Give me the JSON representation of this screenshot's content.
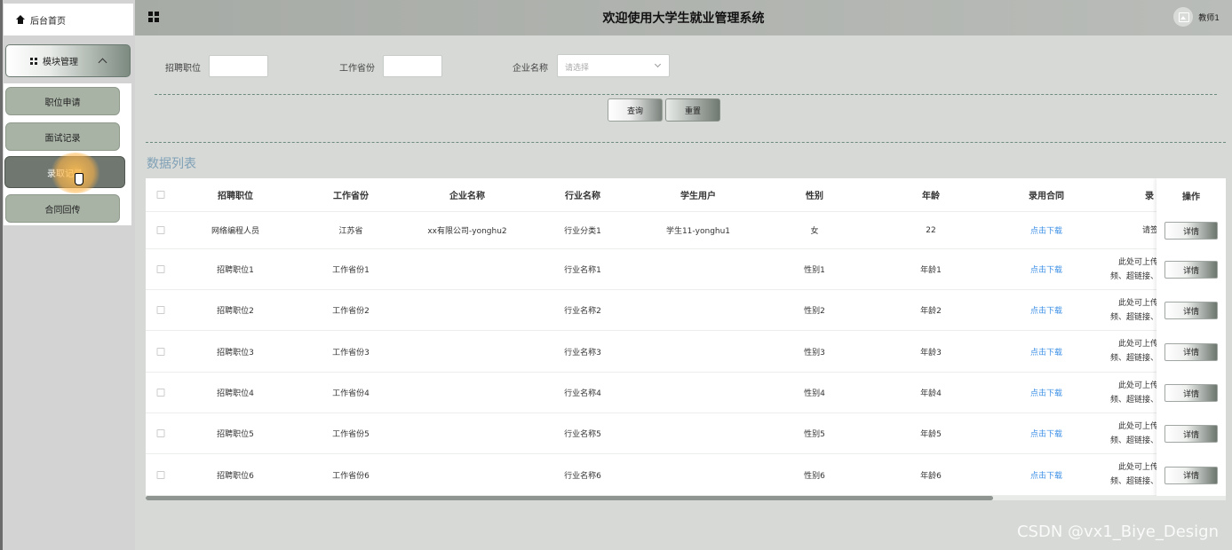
{
  "app": {
    "title": "欢迎使用大学生就业管理系统",
    "user": "教师1"
  },
  "sidebar": {
    "home_label": "后台首页",
    "module_label": "模块管理",
    "items": [
      {
        "label": "职位申请"
      },
      {
        "label": "面试记录"
      },
      {
        "label": "录取记录"
      },
      {
        "label": "合同回传"
      }
    ]
  },
  "filters": {
    "position_label": "招聘职位",
    "province_label": "工作省份",
    "company_label": "企业名称",
    "company_placeholder": "请选择",
    "position_value": "",
    "province_value": ""
  },
  "actions": {
    "query": "查询",
    "reset": "重置"
  },
  "list": {
    "title": "数据列表",
    "columns": [
      "招聘职位",
      "工作省份",
      "企业名称",
      "行业名称",
      "学生用户",
      "性别",
      "年龄",
      "录用合同",
      "录",
      "操作"
    ],
    "rows": [
      {
        "position": "网络编程人员",
        "province": "江苏省",
        "company": "xx有限公司-yonghu2",
        "industry": "行业分类1",
        "student": "学生11-yonghu1",
        "gender": "女",
        "age": "22",
        "contract": "点击下载",
        "extra1": "请签",
        "extra2": ""
      },
      {
        "position": "招聘职位1",
        "province": "工作省份1",
        "company": "",
        "industry": "行业名称1",
        "student": "",
        "gender": "性别1",
        "age": "年龄1",
        "contract": "点击下载",
        "extra1": "此处可上传",
        "extra2": "频、超链接、"
      },
      {
        "position": "招聘职位2",
        "province": "工作省份2",
        "company": "",
        "industry": "行业名称2",
        "student": "",
        "gender": "性别2",
        "age": "年龄2",
        "contract": "点击下载",
        "extra1": "此处可上传",
        "extra2": "频、超链接、"
      },
      {
        "position": "招聘职位3",
        "province": "工作省份3",
        "company": "",
        "industry": "行业名称3",
        "student": "",
        "gender": "性别3",
        "age": "年龄3",
        "contract": "点击下载",
        "extra1": "此处可上传",
        "extra2": "频、超链接、"
      },
      {
        "position": "招聘职位4",
        "province": "工作省份4",
        "company": "",
        "industry": "行业名称4",
        "student": "",
        "gender": "性别4",
        "age": "年龄4",
        "contract": "点击下载",
        "extra1": "此处可上传",
        "extra2": "频、超链接、"
      },
      {
        "position": "招聘职位5",
        "province": "工作省份5",
        "company": "",
        "industry": "行业名称5",
        "student": "",
        "gender": "性别5",
        "age": "年龄5",
        "contract": "点击下载",
        "extra1": "此处可上传",
        "extra2": "频、超链接、"
      },
      {
        "position": "招聘职位6",
        "province": "工作省份6",
        "company": "",
        "industry": "行业名称6",
        "student": "",
        "gender": "性别6",
        "age": "年龄6",
        "contract": "点击下载",
        "extra1": "此处可上传",
        "extra2": "频、超链接、"
      }
    ],
    "detail_label": "详情"
  },
  "watermark": "CSDN @vx1_Biye_Design"
}
